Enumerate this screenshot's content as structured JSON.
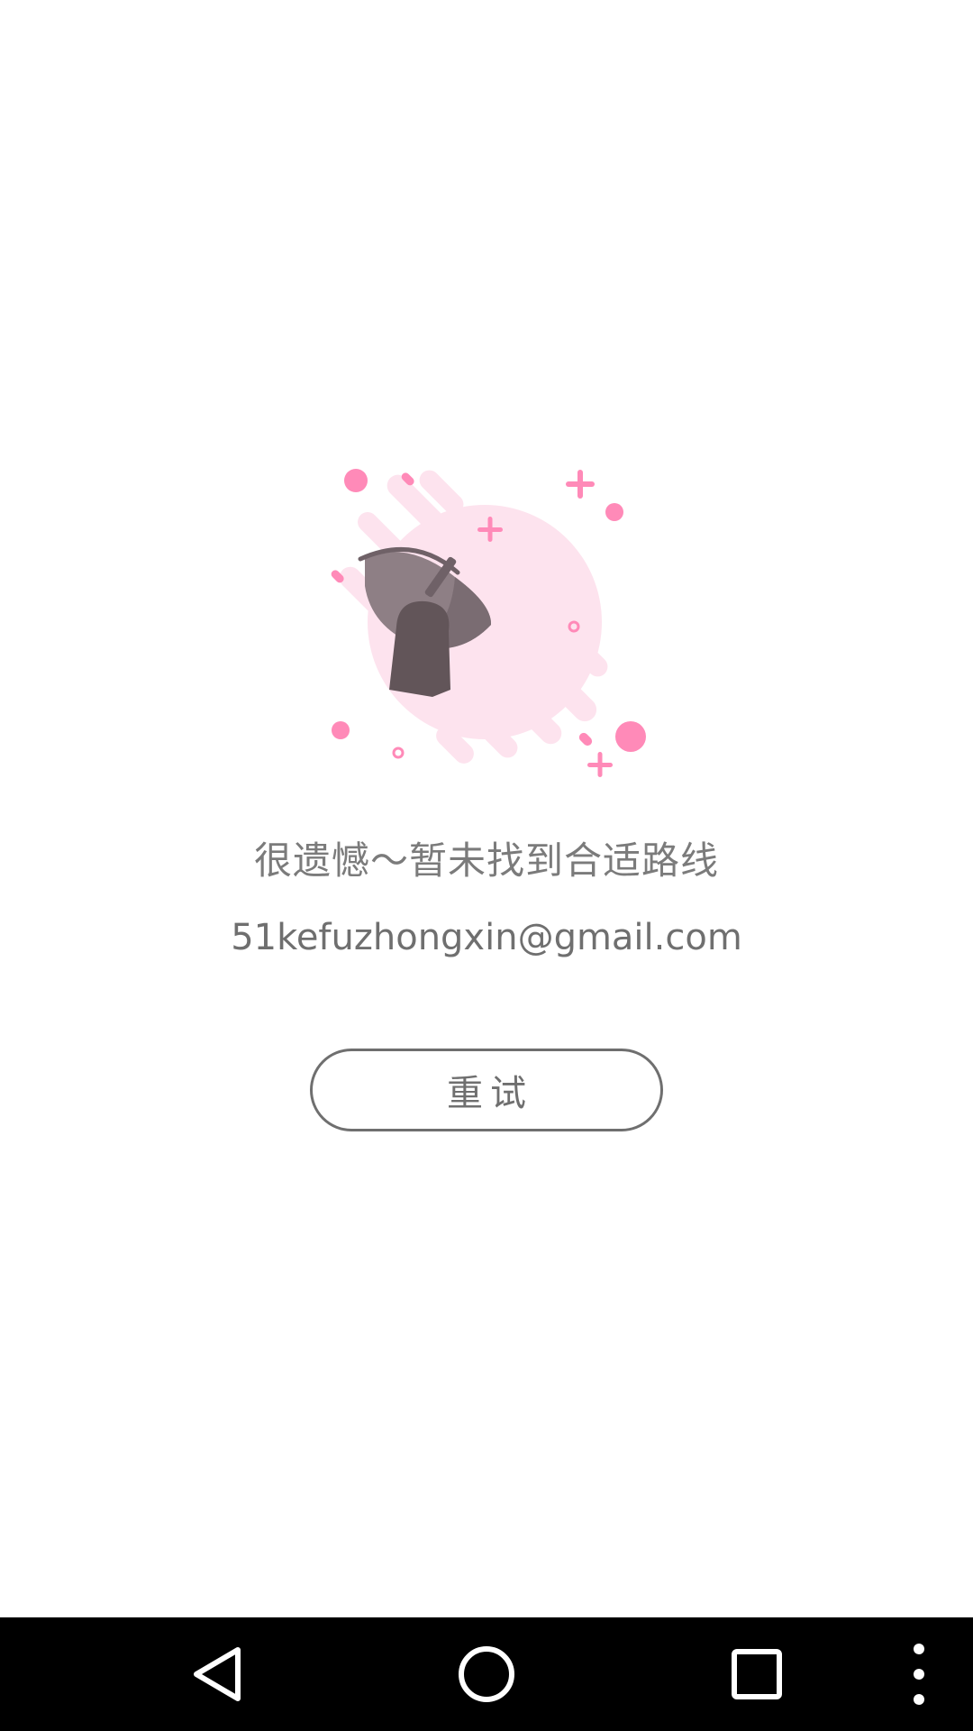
{
  "empty_state": {
    "illustration_icon": "satellite-dish-icon",
    "message": "很遗憾～暂未找到合适路线",
    "email": "51kefuzhongxin@gmail.com",
    "retry_label": "重试"
  },
  "nav_bar": {
    "back_icon": "back-triangle-icon",
    "home_icon": "home-circle-icon",
    "recents_icon": "recents-square-icon",
    "menu_icon": "more-vertical-icon"
  },
  "colors": {
    "text": "#7b7b7b",
    "accent_pink": "#ff8ab8",
    "blob_pink": "#fde3ee",
    "dish_gray": "#8e7f85",
    "nav_background": "#000000"
  }
}
